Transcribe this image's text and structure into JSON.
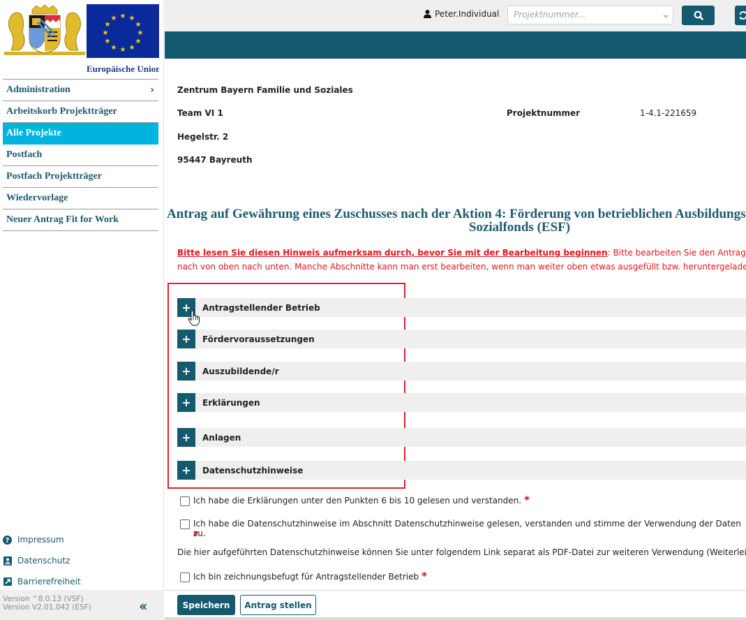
{
  "branding": {
    "eu_label": "Europäische Union",
    "coat_of_arms": "bavaria-coat-of-arms",
    "eu_flag": "eu-flag"
  },
  "header": {
    "user_name": "Peter.Individual",
    "search_placeholder": "Projektnummer...",
    "search_icon": "search-icon",
    "refresh_icon": "refresh-icon"
  },
  "sidebar": {
    "items": [
      {
        "label": "Administration",
        "has_submenu": true,
        "active": false
      },
      {
        "label": "Arbeitskorb Projektträger",
        "active": false
      },
      {
        "label": "Alle Projekte",
        "active": true
      },
      {
        "label": "Postfach",
        "active": false
      },
      {
        "label": "Postfach Projektträger",
        "active": false
      },
      {
        "label": "Wiedervorlage",
        "active": false
      },
      {
        "label": "Neuer Antrag Fit for Work",
        "active": false
      }
    ],
    "footer_links": [
      {
        "label": "Impressum",
        "icon": "question-circle-icon"
      },
      {
        "label": "Datenschutz",
        "icon": "privacy-icon"
      },
      {
        "label": "Barrierefreiheit",
        "icon": "external-link-icon"
      }
    ],
    "version_lines": [
      "Version ^8.0.13 (VSF)",
      "Version V2.01.042 (ESF)"
    ],
    "collapse_icon": "double-chevron-left-icon"
  },
  "address": {
    "org": "Zentrum Bayern Familie und Soziales",
    "team": "Team VI 1",
    "street": "Hegelstr. 2",
    "city": "95447 Bayreuth"
  },
  "project": {
    "label": "Projektnummer",
    "value": "1-4.1-221659"
  },
  "form": {
    "title_line1": "Antrag auf Gewährung eines Zuschusses nach der Aktion 4: Förderung von betrieblichen Ausbildungsplätzen ... Europäischen",
    "title_line2": "Sozialfonds (ESF)",
    "notice_lead": "Bitte lesen Sie diesen Hinweis aufmerksam durch, bevor Sie mit der Bearbeitung beginnen",
    "notice_text": ": Bitte bearbeiten Sie den Antrag der Reihe nach von oben nach unten. Manche Abschnitte kann man erst bearbeiten, wenn man weiter oben etwas ausgefüllt bzw. heruntergeladen hat!",
    "sections": [
      {
        "title": "Antragstellender Betrieb",
        "expanded": false
      },
      {
        "title": "Fördervoraussetzungen",
        "expanded": false
      },
      {
        "title": "Auszubildende/r",
        "expanded": false
      },
      {
        "title": "Erklärungen",
        "expanded": false
      },
      {
        "title": "Anlagen",
        "expanded": false
      },
      {
        "title": "Datenschutzhinweise",
        "expanded": false
      }
    ],
    "checkboxes": [
      {
        "label": "Ich habe die Erklärungen unter den Punkten 6 bis 10 gelesen und verstanden.",
        "checked": false,
        "required": true
      },
      {
        "label": "Ich habe die Datenschutzhinweise im Abschnitt Datenschutzhinweise gelesen, verstanden und stimme der Verwendung der Daten zu.",
        "checked": false,
        "required": true
      },
      {
        "label": "Ich bin zeichnungsbefugt für Antragstellender Betrieb",
        "checked": false,
        "required": true
      }
    ],
    "required_marker": "*",
    "privacy_info": "Die hier aufgeführten Datenschutzhinweise können Sie unter folgendem Link separat als PDF-Datei zur weiteren Verwendung (Weiterleitung"
  },
  "actions": {
    "save_label": "Speichern",
    "submit_label": "Antrag stellen"
  },
  "colors": {
    "primary": "#145a6e",
    "active_nav": "#00b4e0",
    "notice_red": "#e8141c",
    "highlight_border": "#e3202a",
    "section_bg": "#efefef"
  }
}
